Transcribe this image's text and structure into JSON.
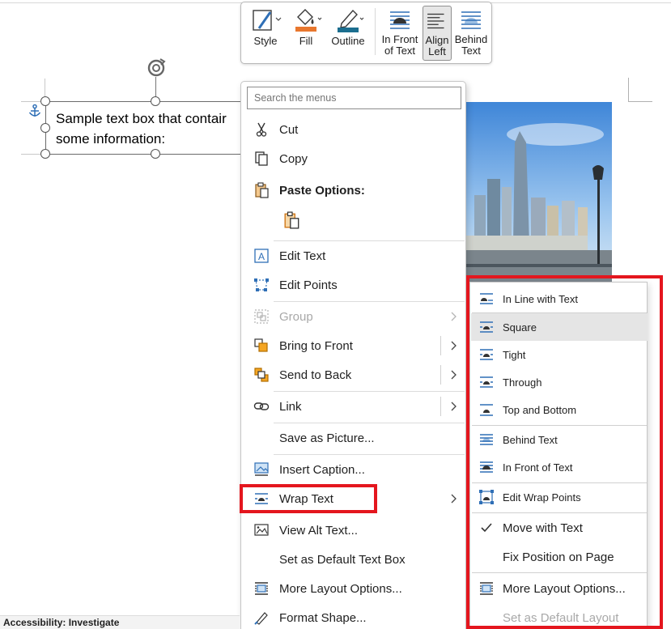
{
  "document": {
    "textbox_line1": "Sample text box that contair",
    "textbox_line2": "some information:"
  },
  "mini_toolbar": {
    "style": "Style",
    "fill": "Fill",
    "outline": "Outline",
    "in_front_line1": "In Front",
    "in_front_line2": "of Text",
    "align_left_line1": "Align",
    "align_left_line2": "Left",
    "behind_line1": "Behind",
    "behind_line2": "Text"
  },
  "context_menu": {
    "search_placeholder": "Search the menus",
    "items": [
      {
        "label": "Cut",
        "icon": "scissors-icon"
      },
      {
        "label": "Copy",
        "icon": "copy-icon"
      },
      {
        "label": "Paste Options:",
        "icon": "paste-icon"
      },
      {
        "label": "",
        "icon": "paste-keep-source-icon"
      },
      {
        "label": "Edit Text",
        "icon": "edit-text-icon"
      },
      {
        "label": "Edit Points",
        "icon": "edit-points-icon"
      },
      {
        "label": "Group",
        "icon": "group-icon",
        "disabled": true
      },
      {
        "label": "Bring to Front",
        "icon": "bring-to-front-icon"
      },
      {
        "label": "Send to Back",
        "icon": "send-to-back-icon"
      },
      {
        "label": "Link",
        "icon": "link-icon"
      },
      {
        "label": "Save as Picture...",
        "icon": ""
      },
      {
        "label": "Insert Caption...",
        "icon": "insert-caption-icon"
      },
      {
        "label": "Wrap Text",
        "icon": "wrap-text-icon"
      },
      {
        "label": "View Alt Text...",
        "icon": "alt-text-icon"
      },
      {
        "label": "Set as Default Text Box",
        "icon": ""
      },
      {
        "label": "More Layout Options...",
        "icon": "layout-options-icon"
      },
      {
        "label": "Format Shape...",
        "icon": "format-shape-icon"
      }
    ]
  },
  "wrap_submenu": {
    "items": [
      {
        "label": "In Line with Text"
      },
      {
        "label": "Square"
      },
      {
        "label": "Tight"
      },
      {
        "label": "Through"
      },
      {
        "label": "Top and Bottom"
      },
      {
        "label": "Behind Text"
      },
      {
        "label": "In Front of Text"
      },
      {
        "label": "Edit Wrap Points"
      },
      {
        "label": "Move with Text",
        "checked": true
      },
      {
        "label": "Fix Position on Page"
      },
      {
        "label": "More Layout Options..."
      },
      {
        "label": "Set as Default Layout",
        "disabled": true
      }
    ]
  },
  "status_bar": {
    "accessibility": "Accessibility: Investigate"
  },
  "colors": {
    "highlight_red": "#e4161e",
    "icon_blue": "#2f6fb6",
    "fill_orange": "#e8772e",
    "outline_teal": "#1b6e8f"
  }
}
